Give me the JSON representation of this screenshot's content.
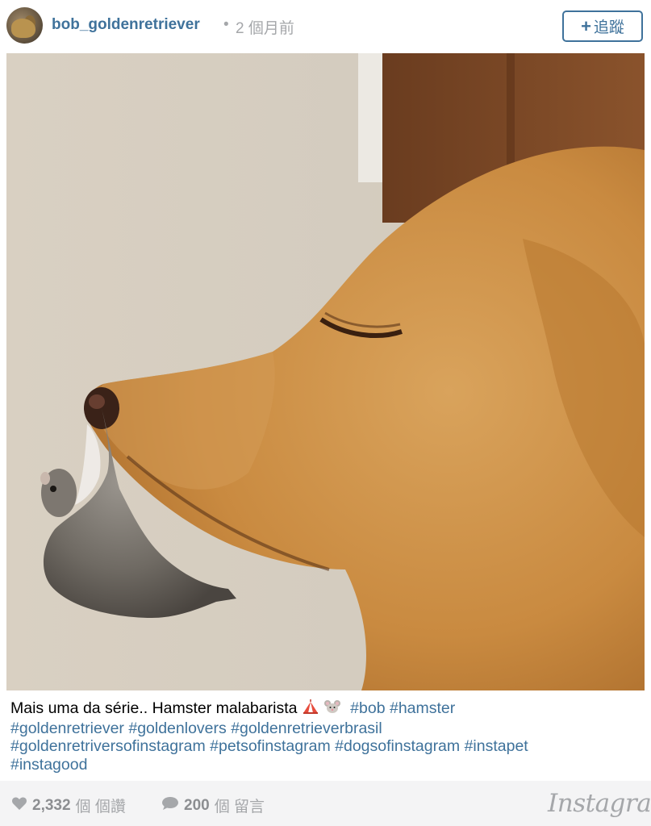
{
  "header": {
    "username": "bob_goldenretriever",
    "separator": "•",
    "time_ago": "2 個月前",
    "follow_plus": "+",
    "follow_label": "追蹤"
  },
  "photo": {
    "alt": "Golden retriever holding a hamster on its nose"
  },
  "caption": {
    "text": "Mais uma da série.. Hamster malabarista",
    "emojis": [
      "circus-tent-icon",
      "mouse-face-icon"
    ],
    "hashtags": [
      "#bob",
      "#hamster",
      "#goldenretriever",
      "#goldenlovers",
      "#goldenretrieverbrasil",
      "#goldenretriversofinstagram",
      "#petsofinstagram",
      "#dogsofinstagram",
      "#instapet",
      "#instagood"
    ]
  },
  "footer": {
    "likes_count": "2,332",
    "likes_unit": "個 個讚",
    "comments_count": "200",
    "comments_unit": "個 留言",
    "brand": "Instagram"
  },
  "colors": {
    "link": "#3f729b",
    "muted": "#a5a7aa",
    "footer_bg": "#f4f4f5"
  }
}
